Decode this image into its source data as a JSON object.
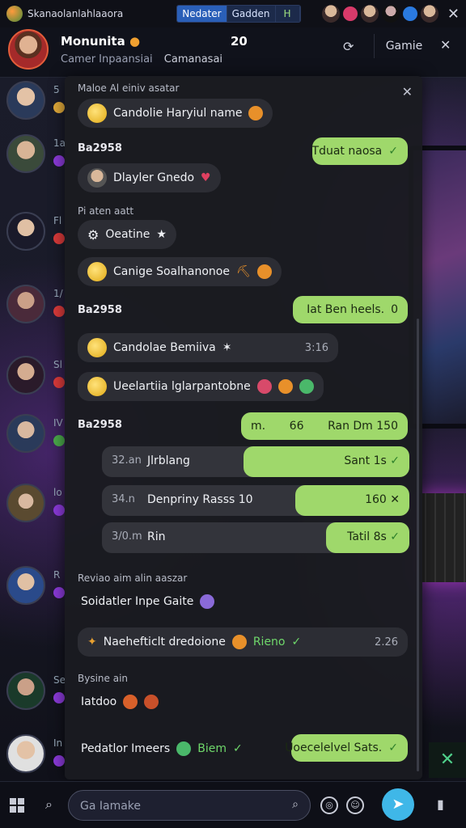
{
  "statusbar": {
    "app_name": "Skanaolanlahlaaora",
    "tabs": [
      "Nedater",
      "Gadden",
      "H"
    ]
  },
  "header": {
    "name": "Monunita",
    "count": "20",
    "subtitle_left": "Camer Inpaansiai",
    "subtitle_right": "Camanasai",
    "game_button": "Gamie"
  },
  "contacts": [
    {
      "tag": "5",
      "dot": "#e0a93a"
    },
    {
      "tag": "1a",
      "dot": "#8a3ad8"
    },
    {
      "tag": "Fl",
      "dot": "#d83a3a"
    },
    {
      "tag": "1/",
      "dot": "#d83a3a"
    },
    {
      "tag": "Sl",
      "dot": "#d83a3a"
    },
    {
      "tag": "IV",
      "dot": "#4aa84a"
    },
    {
      "tag": "lo",
      "dot": "#8a3ad8"
    },
    {
      "tag": "R",
      "dot": "#8a3ad8"
    },
    {
      "tag": "Se",
      "dot": "#8a3ad8"
    },
    {
      "tag": "In",
      "dot": "#8a3ad8"
    }
  ],
  "panel": {
    "top_label": "Maloe Al einiv asatar",
    "msg1": "Candolie Haryiul name",
    "sec1": "Ba2958",
    "green1": "Tduat naosa",
    "msg2": "Dlayler Gnedo",
    "label2": "Pi aten aatt",
    "msg3": "Oeatine",
    "msg4": "Canige Soalhanonoe",
    "sec2": "Ba2958",
    "green2": "Iat Ben heels.",
    "green2_num": "0",
    "msg5": "Candolae Bemiiva",
    "msg5_time": "3:16",
    "msg6": "Ueelartiia lglarpantobne",
    "sec3": "Ba2958",
    "green3_a": "m.",
    "green3_b": "66",
    "green3_c": "Ran Dm 150",
    "rows": [
      {
        "time": "32.an",
        "name": "Jlrblang",
        "fill": 0.54,
        "val": "Sant 1s"
      },
      {
        "time": "34.n",
        "name": "Denpriny Rasss 10",
        "fill": 0.37,
        "val": "160"
      },
      {
        "time": "3/0.m",
        "name": "Rin",
        "fill": 0.27,
        "val": "Tatil 8s"
      }
    ],
    "label3": "Reviao aim alin aaszar",
    "msg7": "Soidatler Inpe Gaite",
    "msg8": "Naehefticlt dredoione",
    "msg8_green": "Rieno",
    "msg8_time": "2.26",
    "label4": "Bysine ain",
    "msg9": "Iatdoo",
    "msg10": "Pedatlor Imeers",
    "msg10_green": "Biem",
    "green4": "Uoecelelvel Sats."
  },
  "composer": {
    "placeholder": "Ga Iamake"
  }
}
